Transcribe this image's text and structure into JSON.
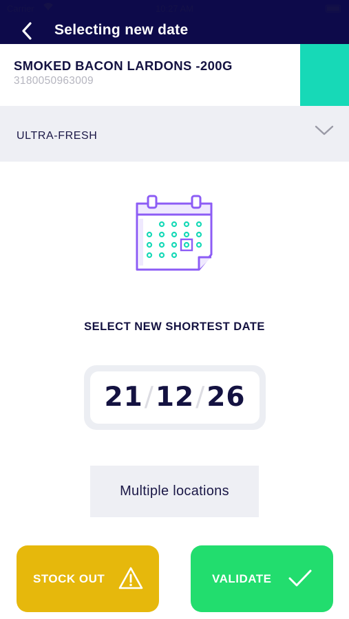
{
  "status_bar": {
    "carrier": "Carrier",
    "time": "10:27 AM"
  },
  "header": {
    "title": "Selecting new date"
  },
  "product": {
    "name": "SMOKED BACON LARDONS -200G",
    "code": "3180050963009",
    "accent_color": "#17d9b7"
  },
  "category": {
    "selected": "ULTRA-FRESH"
  },
  "instruction": "SELECT NEW SHORTEST DATE",
  "date": {
    "day": "21",
    "month": "12",
    "year": "26",
    "separator": "/"
  },
  "locations": {
    "label": "Multiple locations"
  },
  "actions": {
    "stock_out": {
      "label": "STOCK OUT",
      "color": "#e6b80c",
      "icon": "warning-icon"
    },
    "validate": {
      "label": "VALIDATE",
      "color": "#22dd6e",
      "icon": "check-icon"
    }
  },
  "colors": {
    "navy": "#0d0a4a",
    "turquoise": "#17d9b7",
    "purple": "#8c5cf5"
  }
}
